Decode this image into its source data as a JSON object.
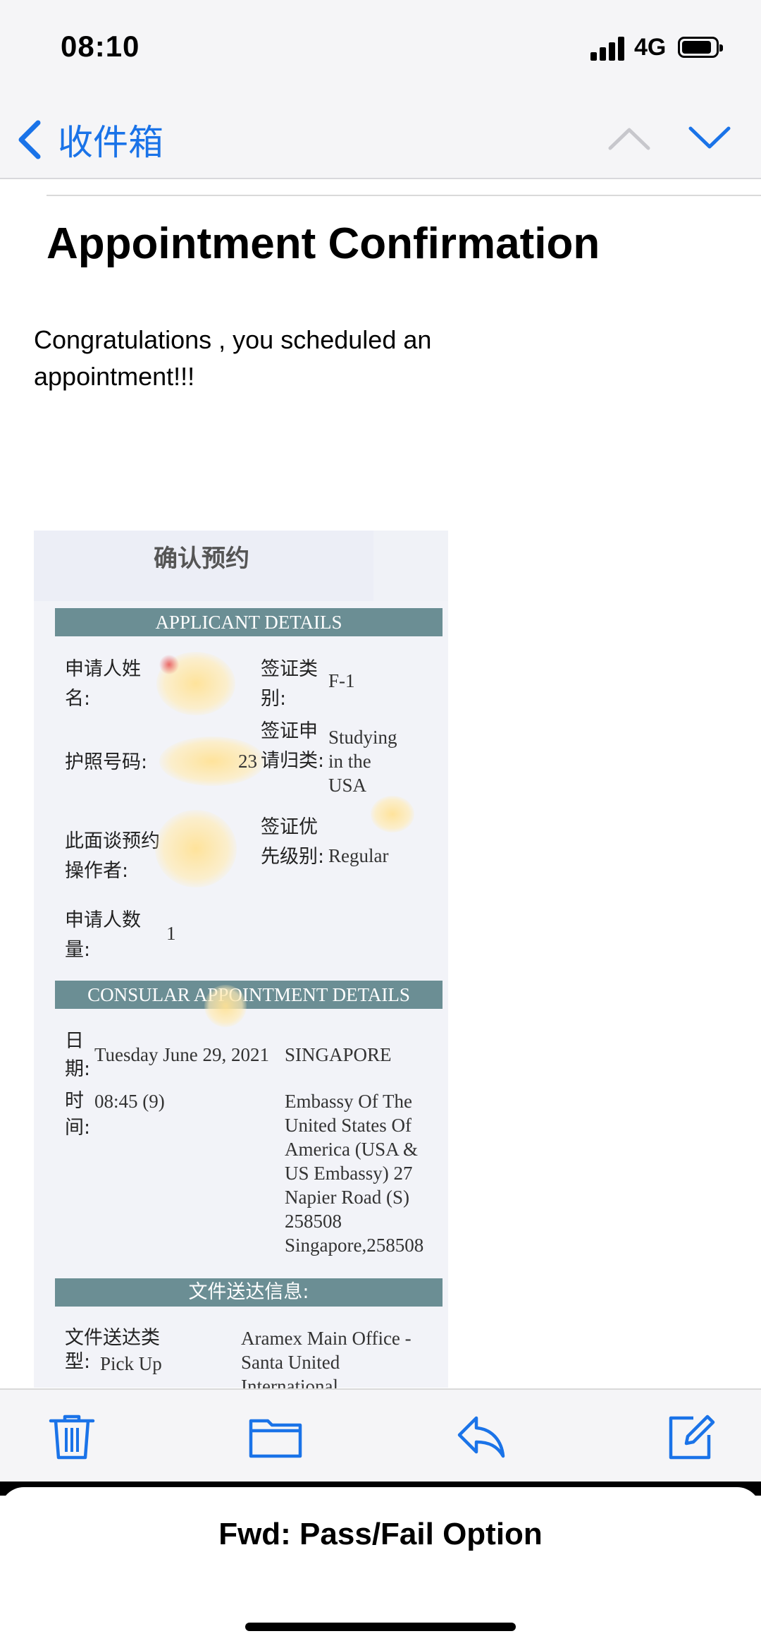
{
  "status_bar": {
    "time": "08:10",
    "network": "4G"
  },
  "nav": {
    "back_label": "收件箱"
  },
  "email": {
    "subject": "Appointment Confirmation",
    "body": "Congratulations , you scheduled an appointment!!!"
  },
  "attachment": {
    "title": "确认预约",
    "applicant_header": "APPLICANT DETAILS",
    "applicant_name_label": "申请人姓名:",
    "visa_type_label": "签证类别:",
    "visa_type_value": "F-1",
    "passport_label": "护照号码:",
    "passport_tail": "23",
    "visa_category_label": "签证申请归类:",
    "visa_category_value": "Studying in the USA",
    "operator_label": "此面谈预约操作者:",
    "priority_label": "签证优先级别:",
    "priority_value": "Regular",
    "applicant_count_label": "申请人数量:",
    "applicant_count_value": "1",
    "consular_header": "CONSULAR APPOINTMENT DETAILS",
    "date_label": "日期:",
    "date_value": "Tuesday June 29, 2021",
    "location_city": "SINGAPORE",
    "time_label": "时间:",
    "time_value": "08:45 (9)",
    "embassy_address": "Embassy Of The United States Of America (USA & US Embassy) 27 Napier Road (S) 258508 Singapore,258508",
    "doc_header": "文件送达信息:",
    "doc_type_label": "文件送达类型:",
    "doc_type_value": "Pick Up",
    "doc_address": "Aramex Main Office - Santa United International"
  },
  "toolbar": {
    "icons": [
      "trash-icon",
      "folder-icon",
      "reply-icon",
      "compose-icon"
    ]
  },
  "sheet": {
    "title": "Fwd: Pass/Fail Option"
  },
  "colors": {
    "accent": "#1a73e8",
    "table_header": "#6b8e94"
  }
}
